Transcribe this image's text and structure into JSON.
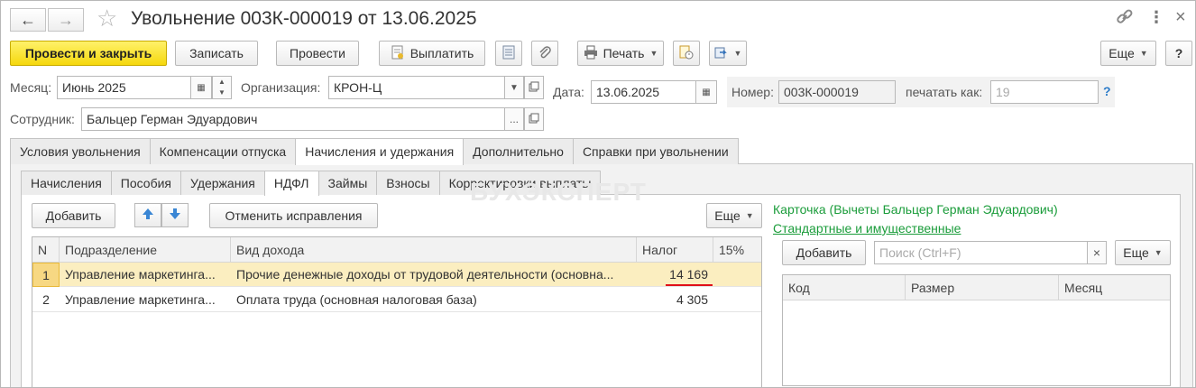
{
  "window": {
    "title": "Увольнение 003К-000019 от 13.06.2025"
  },
  "toolbar": {
    "post_close": "Провести и закрыть",
    "save": "Записать",
    "post": "Провести",
    "pay": "Выплатить",
    "print": "Печать",
    "more": "Еще",
    "help": "?"
  },
  "form": {
    "month_label": "Месяц:",
    "month_value": "Июнь 2025",
    "org_label": "Организация:",
    "org_value": "КРОН-Ц",
    "date_label": "Дата:",
    "date_value": "13.06.2025",
    "number_label": "Номер:",
    "number_value": "003К-000019",
    "print_as_label": "печатать как:",
    "print_as_placeholder": "19",
    "employee_label": "Сотрудник:",
    "employee_value": "Бальцер Герман Эдуардович",
    "help_mark": "?"
  },
  "tabs": [
    "Условия увольнения",
    "Компенсации отпуска",
    "Начисления и удержания",
    "Дополнительно",
    "Справки при увольнении"
  ],
  "subtabs": [
    "Начисления",
    "Пособия",
    "Удержания",
    "НДФЛ",
    "Займы",
    "Взносы",
    "Корректировки выплаты"
  ],
  "watermark": "БУХЭКСПЕРТ",
  "ndfl": {
    "add": "Добавить",
    "cancel_fix": "Отменить исправления",
    "more": "Еще",
    "columns": [
      "N",
      "Подразделение",
      "Вид дохода",
      "Налог",
      "15%"
    ],
    "rows": [
      {
        "n": "1",
        "dept": "Управление маркетинга...",
        "income": "Прочие денежные доходы от трудовой деятельности (основна...",
        "tax": "14 169"
      },
      {
        "n": "2",
        "dept": "Управление маркетинга...",
        "income": "Оплата труда (основная налоговая база)",
        "tax": "4 305"
      }
    ]
  },
  "card": {
    "title": "Карточка (Вычеты Бальцер Герман Эдуардович)",
    "link": "Стандартные и имущественные",
    "add": "Добавить",
    "search_placeholder": "Поиск (Ctrl+F)",
    "clear": "×",
    "more": "Еще",
    "columns": [
      "Код",
      "Размер",
      "Месяц"
    ]
  },
  "colors": {
    "primary_button": "#f5d80d",
    "selected_row": "#fbeec0",
    "link_green": "#1a9c3a",
    "highlight_underline": "#e0101a"
  }
}
